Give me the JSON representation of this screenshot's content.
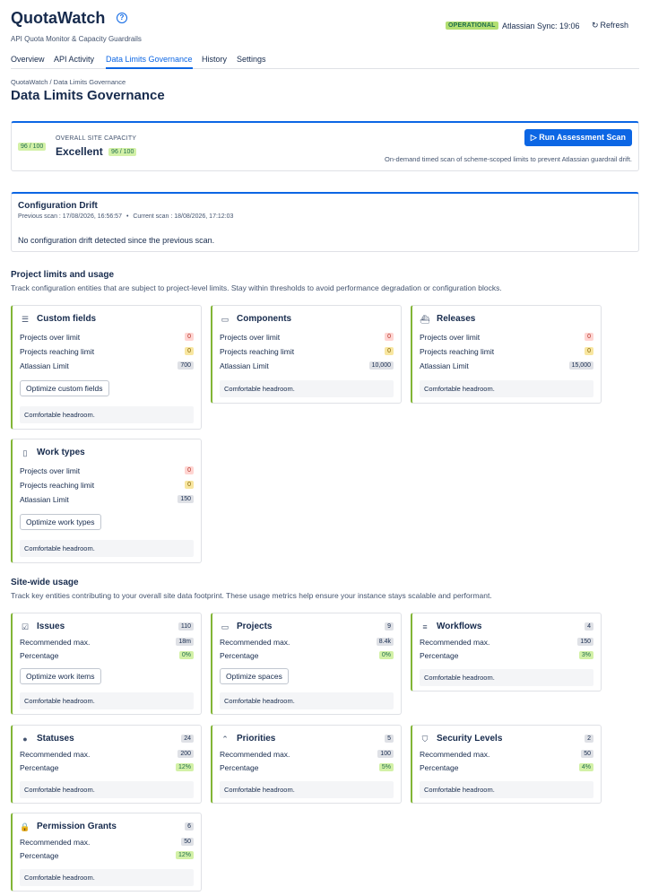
{
  "app": {
    "title": "QuotaWatch",
    "subtitle": "API Quota Monitor & Capacity Guardrails",
    "status": "OPERATIONAL",
    "sync": "Atlassian Sync: 19:06",
    "refresh_label": "Refresh"
  },
  "tabs": [
    "Overview",
    "API Activity",
    "Data Limits Governance",
    "History",
    "Settings"
  ],
  "active_tab": "Data Limits Governance",
  "breadcrumb": "QuotaWatch / Data Limits Governance",
  "page_title": "Data Limits Governance",
  "capacity": {
    "score": "96 / 100",
    "label": "OVERALL SITE CAPACITY",
    "rating": "Excellent",
    "rating_score": "96 / 100",
    "run_button": "Run Assessment Scan",
    "description": "On-demand timed scan of scheme-scoped limits to prevent Atlassian guardrail drift."
  },
  "drift": {
    "title": "Configuration Drift",
    "previous_scan": "Previous scan : 17/08/2026, 16:56:57",
    "separator": "•",
    "current_scan": "Current scan : 18/08/2026, 17:12:03",
    "message": "No configuration drift detected since the previous scan."
  },
  "project_section": {
    "title": "Project limits and usage",
    "description": "Track configuration entities that are subject to project-level limits. Stay within thresholds to avoid performance degradation or configuration blocks.",
    "row_labels": {
      "over": "Projects over limit",
      "reaching": "Projects reaching limit",
      "limit": "Atlassian Limit"
    },
    "cards": [
      {
        "title": "Custom fields",
        "icon": "list-icon",
        "over": "0",
        "reaching": "0",
        "limit": "700",
        "button": "Optimize custom fields",
        "note": "Comfortable headroom."
      },
      {
        "title": "Components",
        "icon": "components-icon",
        "over": "0",
        "reaching": "0",
        "limit": "10,000",
        "note": "Comfortable headroom."
      },
      {
        "title": "Releases",
        "icon": "ship-icon",
        "over": "0",
        "reaching": "0",
        "limit": "15,000",
        "note": "Comfortable headroom."
      },
      {
        "title": "Work types",
        "icon": "work-type-icon",
        "over": "0",
        "reaching": "0",
        "limit": "150",
        "button": "Optimize work types",
        "note": "Comfortable headroom."
      }
    ]
  },
  "site_section": {
    "title": "Site-wide usage",
    "description": "Track key entities contributing to your overall site data footprint. These usage metrics help ensure your instance stays scalable and performant.",
    "row_labels": {
      "max": "Recommended max.",
      "pct": "Percentage"
    },
    "cards": [
      {
        "title": "Issues",
        "icon": "checkbox-icon",
        "count": "110",
        "max": "18m",
        "pct": "0%",
        "button": "Optimize work items",
        "note": "Comfortable headroom."
      },
      {
        "title": "Projects",
        "icon": "folder-icon",
        "count": "9",
        "max": "8.4k",
        "pct": "0%",
        "button": "Optimize spaces",
        "note": "Comfortable headroom."
      },
      {
        "title": "Workflows",
        "icon": "workflow-icon",
        "count": "4",
        "max": "150",
        "pct": "3%",
        "note": "Comfortable headroom."
      },
      {
        "title": "Statuses",
        "icon": "info-icon",
        "count": "24",
        "max": "200",
        "pct": "12%",
        "note": "Comfortable headroom."
      },
      {
        "title": "Priorities",
        "icon": "chevron-up-icon",
        "count": "5",
        "max": "100",
        "pct": "5%",
        "note": "Comfortable headroom."
      },
      {
        "title": "Security Levels",
        "icon": "shield-icon",
        "count": "2",
        "max": "50",
        "pct": "4%",
        "note": "Comfortable headroom."
      },
      {
        "title": "Permission Grants",
        "icon": "lock-icon",
        "count": "6",
        "max": "50",
        "pct": "12%",
        "note": "Comfortable headroom."
      }
    ]
  },
  "colors": {
    "accent": "#0c66e4",
    "card_border": "#82b536",
    "ok": "#d3f1a7",
    "danger": "#ffd5d2",
    "warning": "#f8e6a0"
  }
}
